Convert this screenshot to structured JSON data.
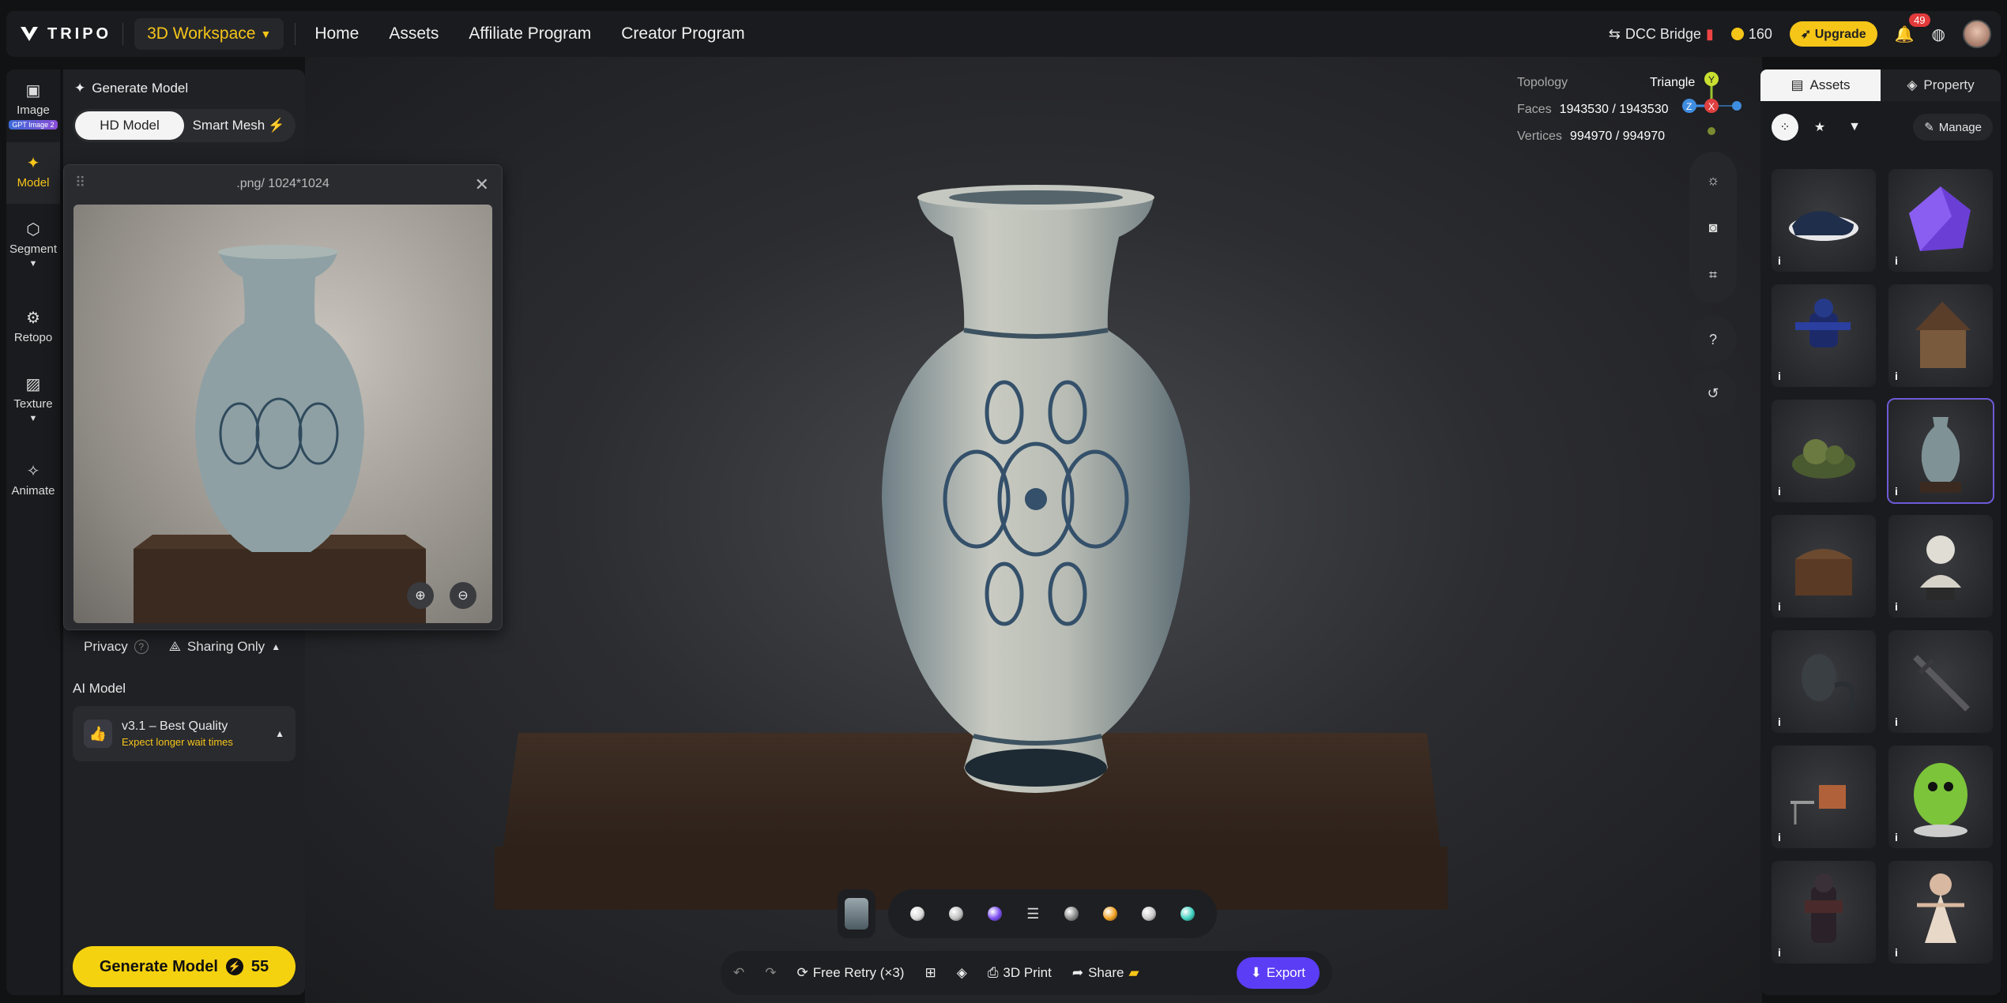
{
  "topbar": {
    "brand": "TRIPO",
    "workspace_label": "3D Workspace",
    "nav": [
      "Home",
      "Assets",
      "Affiliate Program",
      "Creator Program"
    ],
    "dcc_label": "DCC Bridge",
    "credits": "160",
    "upgrade_label": "Upgrade",
    "notif_count": "49"
  },
  "rail": {
    "items": [
      {
        "label": "Image",
        "icon": "image-icon",
        "badge": "GPT Image 2"
      },
      {
        "label": "Model",
        "icon": "sparkle-icon"
      },
      {
        "label": "Segment",
        "icon": "cube-icon"
      },
      {
        "label": "Retopo",
        "icon": "retopo-icon"
      },
      {
        "label": "Texture",
        "icon": "texture-icon"
      },
      {
        "label": "Animate",
        "icon": "figure-icon"
      }
    ]
  },
  "panel": {
    "title": "Generate Model",
    "mode_hd": "HD Model",
    "mode_smart": "Smart Mesh",
    "privacy_label": "Privacy",
    "sharing_label": "Sharing Only",
    "ai_model_label": "AI Model",
    "ai_model_name": "v3.1 – Best Quality",
    "ai_model_note": "Expect longer wait times",
    "generate_label": "Generate Model",
    "generate_cost": "55"
  },
  "preview": {
    "caption": ".png/ 1024*1024"
  },
  "viewport": {
    "topology_label": "Topology",
    "topology_value": "Triangle",
    "faces_label": "Faces",
    "faces_value": "1943530 / 1943530",
    "vertices_label": "Vertices",
    "vertices_value": "994970 / 994970",
    "axis_y": "Y",
    "axis_z": "Z",
    "axis_x": "X"
  },
  "actions": {
    "free_retry": "Free Retry (×3)",
    "print": "3D Print",
    "share": "Share",
    "export": "Export"
  },
  "materials": [
    "#d8d8d8",
    "#bfbfbf",
    "#7a4cf0",
    "#888888",
    "#f0a020",
    "#c8c8c8",
    "#3fd0c0"
  ],
  "assets": {
    "tab_assets": "Assets",
    "tab_property": "Property",
    "manage_label": "Manage",
    "info_glyph": "i",
    "items": [
      "sneaker",
      "purple-crystal",
      "armored-robot",
      "cottage",
      "mossy-rocks",
      "ceramic-vase",
      "treasure-chest",
      "marble-bust",
      "alien-creature",
      "sword",
      "chair-and-table",
      "green-creature",
      "dark-knight",
      "doll-girl"
    ]
  }
}
